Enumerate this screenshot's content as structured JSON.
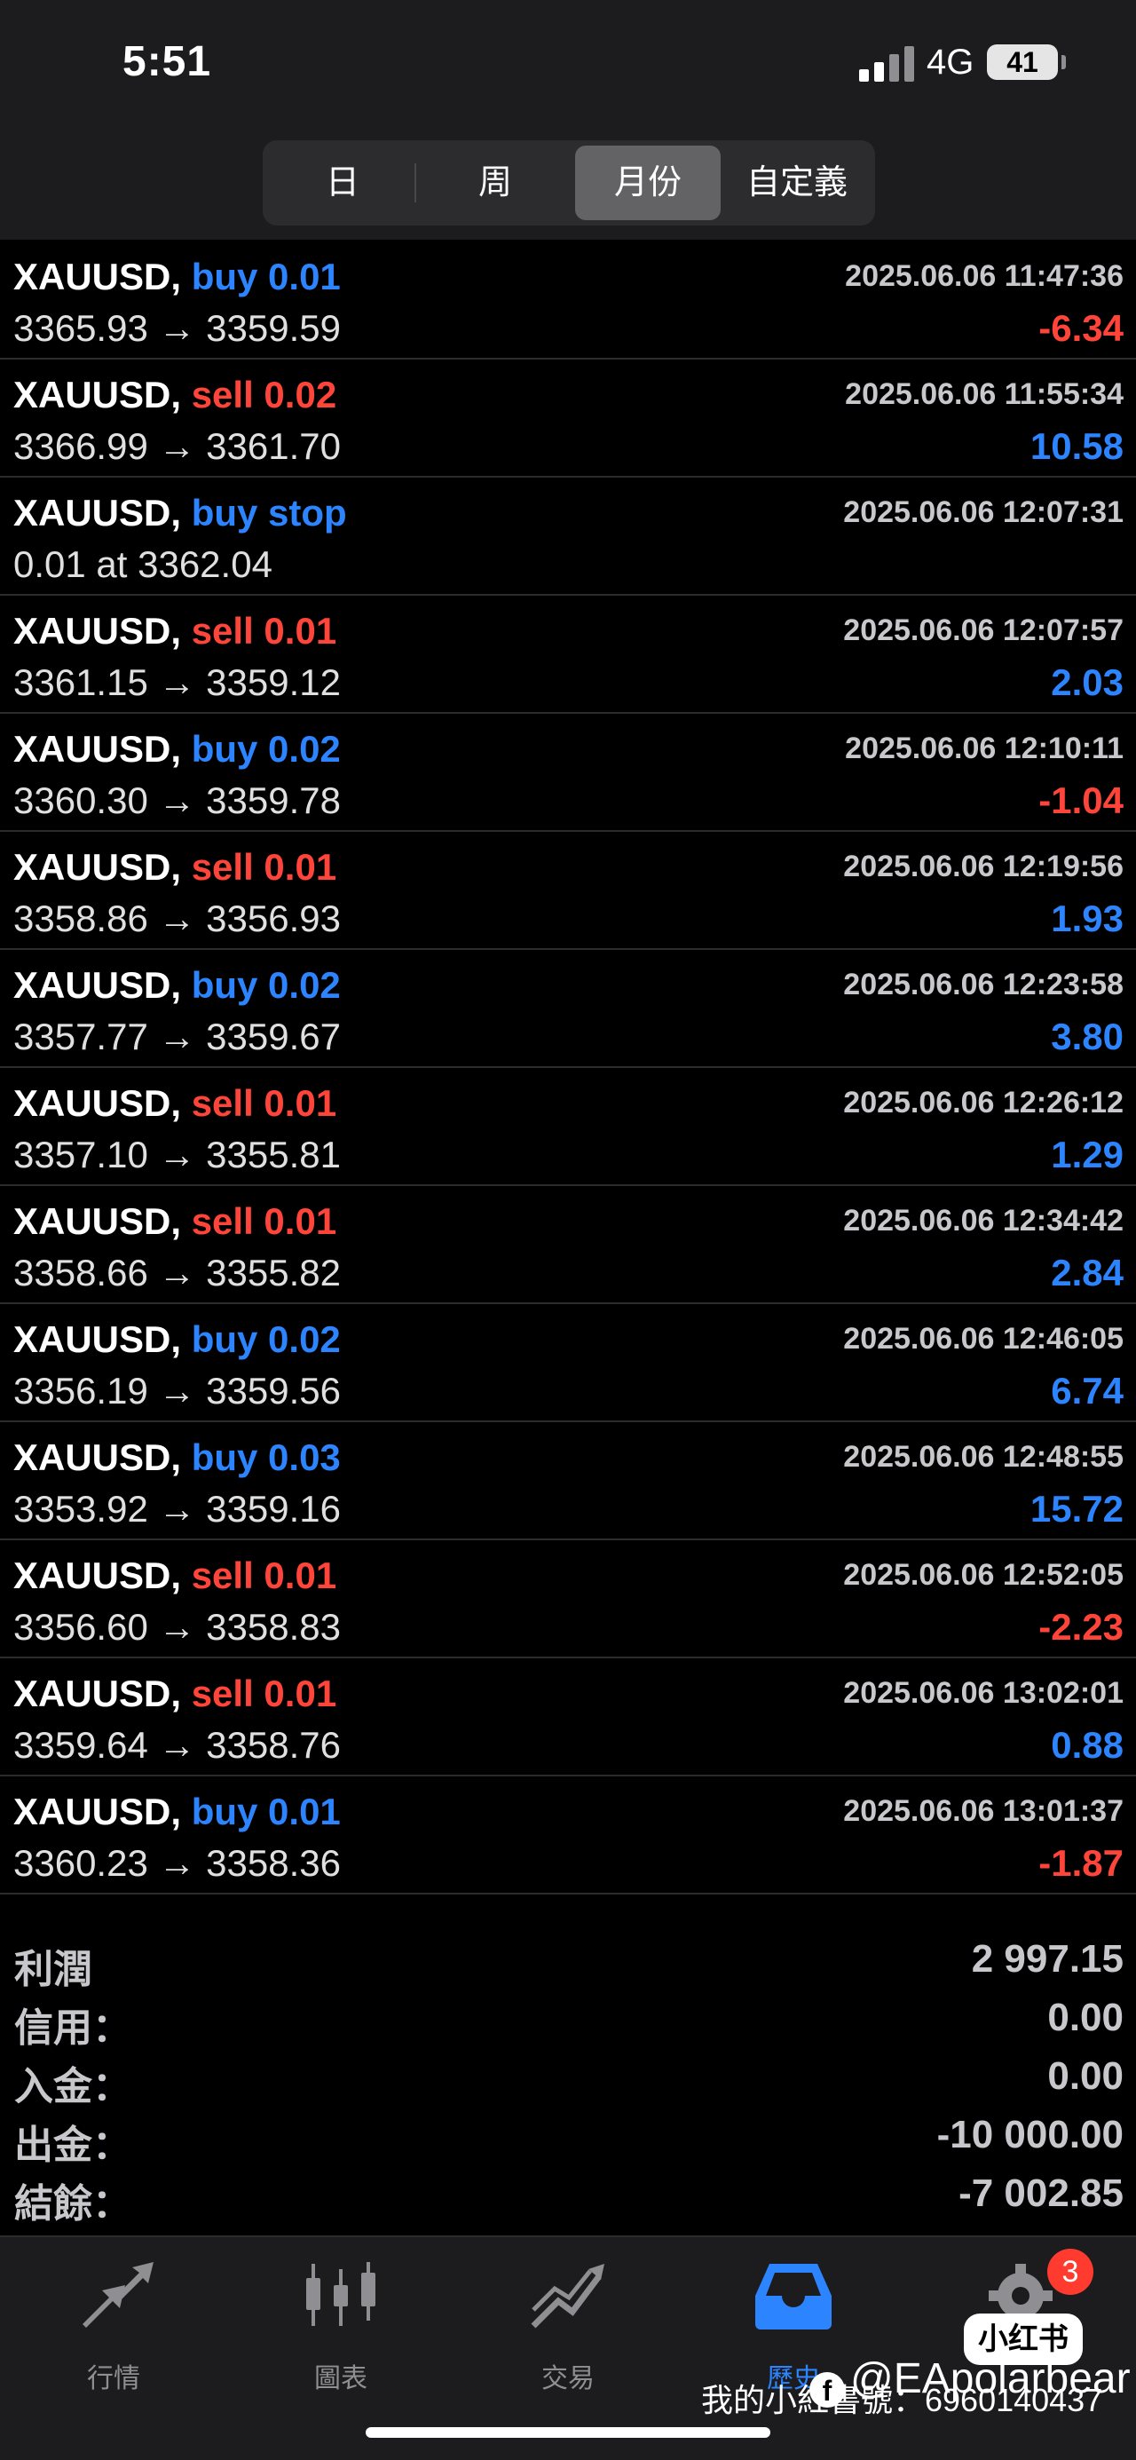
{
  "status": {
    "time": "5:51",
    "network": "4G",
    "battery": "41"
  },
  "segments": [
    {
      "label": "日",
      "active": false
    },
    {
      "label": "周",
      "active": false
    },
    {
      "label": "月份",
      "active": true
    },
    {
      "label": "自定義",
      "active": false
    }
  ],
  "trades": [
    {
      "symbol": "XAUUSD,",
      "side_text": "buy 0.01",
      "side": "buy",
      "prices": "3365.93 → 3359.59",
      "time": "2025.06.06 11:47:36",
      "profit": "-6.34"
    },
    {
      "symbol": "XAUUSD,",
      "side_text": "sell 0.02",
      "side": "sell",
      "prices": "3366.99 → 3361.70",
      "time": "2025.06.06 11:55:34",
      "profit": "10.58"
    },
    {
      "symbol": "XAUUSD,",
      "side_text": "buy stop",
      "side": "buy",
      "prices": "0.01 at 3362.04",
      "time": "2025.06.06 12:07:31",
      "profit": ""
    },
    {
      "symbol": "XAUUSD,",
      "side_text": "sell 0.01",
      "side": "sell",
      "prices": "3361.15 → 3359.12",
      "time": "2025.06.06 12:07:57",
      "profit": "2.03"
    },
    {
      "symbol": "XAUUSD,",
      "side_text": "buy 0.02",
      "side": "buy",
      "prices": "3360.30 → 3359.78",
      "time": "2025.06.06 12:10:11",
      "profit": "-1.04"
    },
    {
      "symbol": "XAUUSD,",
      "side_text": "sell 0.01",
      "side": "sell",
      "prices": "3358.86 → 3356.93",
      "time": "2025.06.06 12:19:56",
      "profit": "1.93"
    },
    {
      "symbol": "XAUUSD,",
      "side_text": "buy 0.02",
      "side": "buy",
      "prices": "3357.77 → 3359.67",
      "time": "2025.06.06 12:23:58",
      "profit": "3.80"
    },
    {
      "symbol": "XAUUSD,",
      "side_text": "sell 0.01",
      "side": "sell",
      "prices": "3357.10 → 3355.81",
      "time": "2025.06.06 12:26:12",
      "profit": "1.29"
    },
    {
      "symbol": "XAUUSD,",
      "side_text": "sell 0.01",
      "side": "sell",
      "prices": "3358.66 → 3355.82",
      "time": "2025.06.06 12:34:42",
      "profit": "2.84"
    },
    {
      "symbol": "XAUUSD,",
      "side_text": "buy 0.02",
      "side": "buy",
      "prices": "3356.19 → 3359.56",
      "time": "2025.06.06 12:46:05",
      "profit": "6.74"
    },
    {
      "symbol": "XAUUSD,",
      "side_text": "buy 0.03",
      "side": "buy",
      "prices": "3353.92 → 3359.16",
      "time": "2025.06.06 12:48:55",
      "profit": "15.72"
    },
    {
      "symbol": "XAUUSD,",
      "side_text": "sell 0.01",
      "side": "sell",
      "prices": "3356.60 → 3358.83",
      "time": "2025.06.06 12:52:05",
      "profit": "-2.23"
    },
    {
      "symbol": "XAUUSD,",
      "side_text": "sell 0.01",
      "side": "sell",
      "prices": "3359.64 → 3358.76",
      "time": "2025.06.06 13:02:01",
      "profit": "0.88"
    },
    {
      "symbol": "XAUUSD,",
      "side_text": "buy 0.01",
      "side": "buy",
      "prices": "3360.23 → 3358.36",
      "time": "2025.06.06 13:01:37",
      "profit": "-1.87"
    }
  ],
  "summary": [
    {
      "label": "利潤",
      "value": "2 997.15"
    },
    {
      "label": "信用：",
      "value": "0.00"
    },
    {
      "label": "入金：",
      "value": "0.00"
    },
    {
      "label": "出金：",
      "value": "-10 000.00"
    },
    {
      "label": "結餘：",
      "value": "-7 002.85"
    }
  ],
  "tabs": [
    {
      "label": "行情",
      "icon": "quotes-arrows-icon",
      "active": false
    },
    {
      "label": "圖表",
      "icon": "candlestick-chart-icon",
      "active": false
    },
    {
      "label": "交易",
      "icon": "trade-chart-icon",
      "active": false
    },
    {
      "label": "歷史",
      "icon": "history-inbox-icon",
      "active": true
    },
    {
      "label": "",
      "icon": "settings-gear-icon",
      "active": false
    }
  ],
  "badge": "3",
  "overlay": {
    "logo": "小红书",
    "watermark_text": "我的小紅書號：6960140437",
    "handle": "@EApolarbear"
  },
  "colors": {
    "buy": "#2d84ff",
    "sell": "#ff453a",
    "active_tab": "#2d84ff",
    "background": "#000000"
  }
}
